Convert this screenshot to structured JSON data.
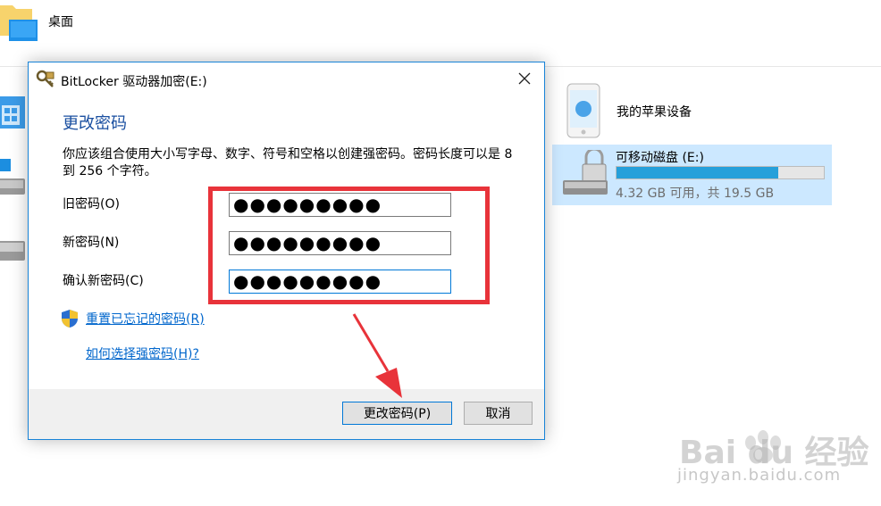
{
  "explorer": {
    "desktop_label": "桌面",
    "device_label": "我的苹果设备",
    "drive": {
      "name": "可移动磁盘 (E:)",
      "free_text": "4.32 GB 可用，共 19.5 GB",
      "used_fraction": 0.78
    }
  },
  "dialog": {
    "title": "BitLocker 驱动器加密(E:)",
    "heading": "更改密码",
    "description": "你应该组合使用大小写字母、数字、符号和空格以创建强密码。密码长度可以是 8 到 256 个字符。",
    "fields": [
      {
        "label": "旧密码(O)",
        "value": "●●●●●●●●●"
      },
      {
        "label": "新密码(N)",
        "value": "●●●●●●●●●"
      },
      {
        "label": "确认新密码(C)",
        "value": "●●●●●●●●●"
      }
    ],
    "reset_link": "重置已忘记的密码(R)",
    "help_link": "如何选择强密码(H)?",
    "buttons": {
      "primary": "更改密码(P)",
      "cancel": "取消"
    }
  },
  "watermark": {
    "text": "Bai du 经验",
    "url": "jingyan.baidu.com"
  },
  "colors": {
    "accent": "#0078d7",
    "heading": "#1a4fa0",
    "link": "#0066cc",
    "annotation": "#e8333a",
    "drive_tile": "#cce8ff",
    "drive_fill": "#26a0da"
  }
}
